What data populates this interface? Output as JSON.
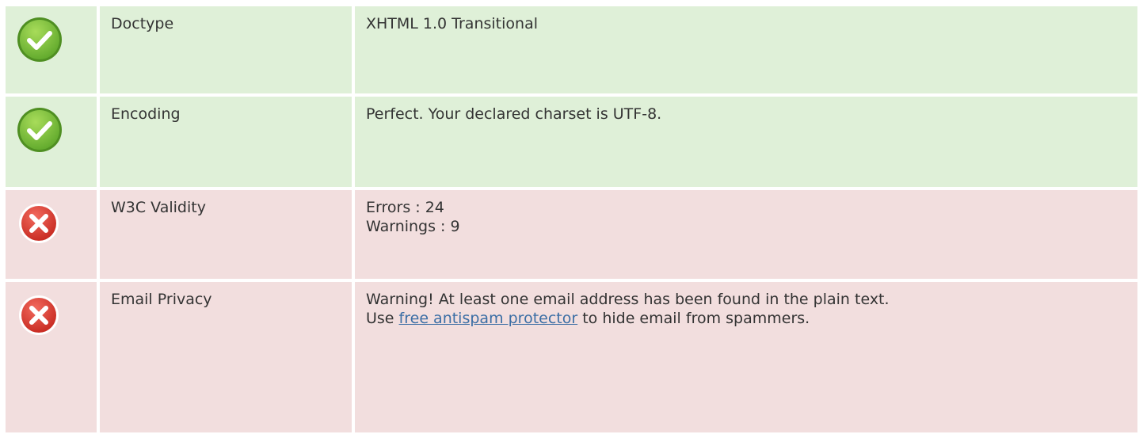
{
  "rows": [
    {
      "status": "pass",
      "icon": "check-circle-icon",
      "name": "Doctype",
      "value_lines": [
        "XHTML 1.0 Transitional"
      ]
    },
    {
      "status": "pass",
      "icon": "check-circle-icon",
      "name": "Encoding",
      "value_lines": [
        "Perfect. Your declared charset is UTF-8."
      ]
    },
    {
      "status": "fail",
      "icon": "x-circle-icon",
      "name": "W3C Validity",
      "value_lines": [
        "Errors : 24",
        "Warnings : 9"
      ]
    },
    {
      "status": "fail",
      "icon": "x-circle-icon",
      "name": "Email Privacy",
      "value_line1": "Warning! At least one email address has been found in the plain text.",
      "value_pre": "Use ",
      "link_text": "free antispam protector",
      "value_post": " to hide email from spammers."
    }
  ],
  "colors": {
    "pass_bg": "#dff0d8",
    "fail_bg": "#f2dede",
    "link": "#3b6ea5",
    "check_green": "#7cc242",
    "x_red": "#d9342b"
  }
}
